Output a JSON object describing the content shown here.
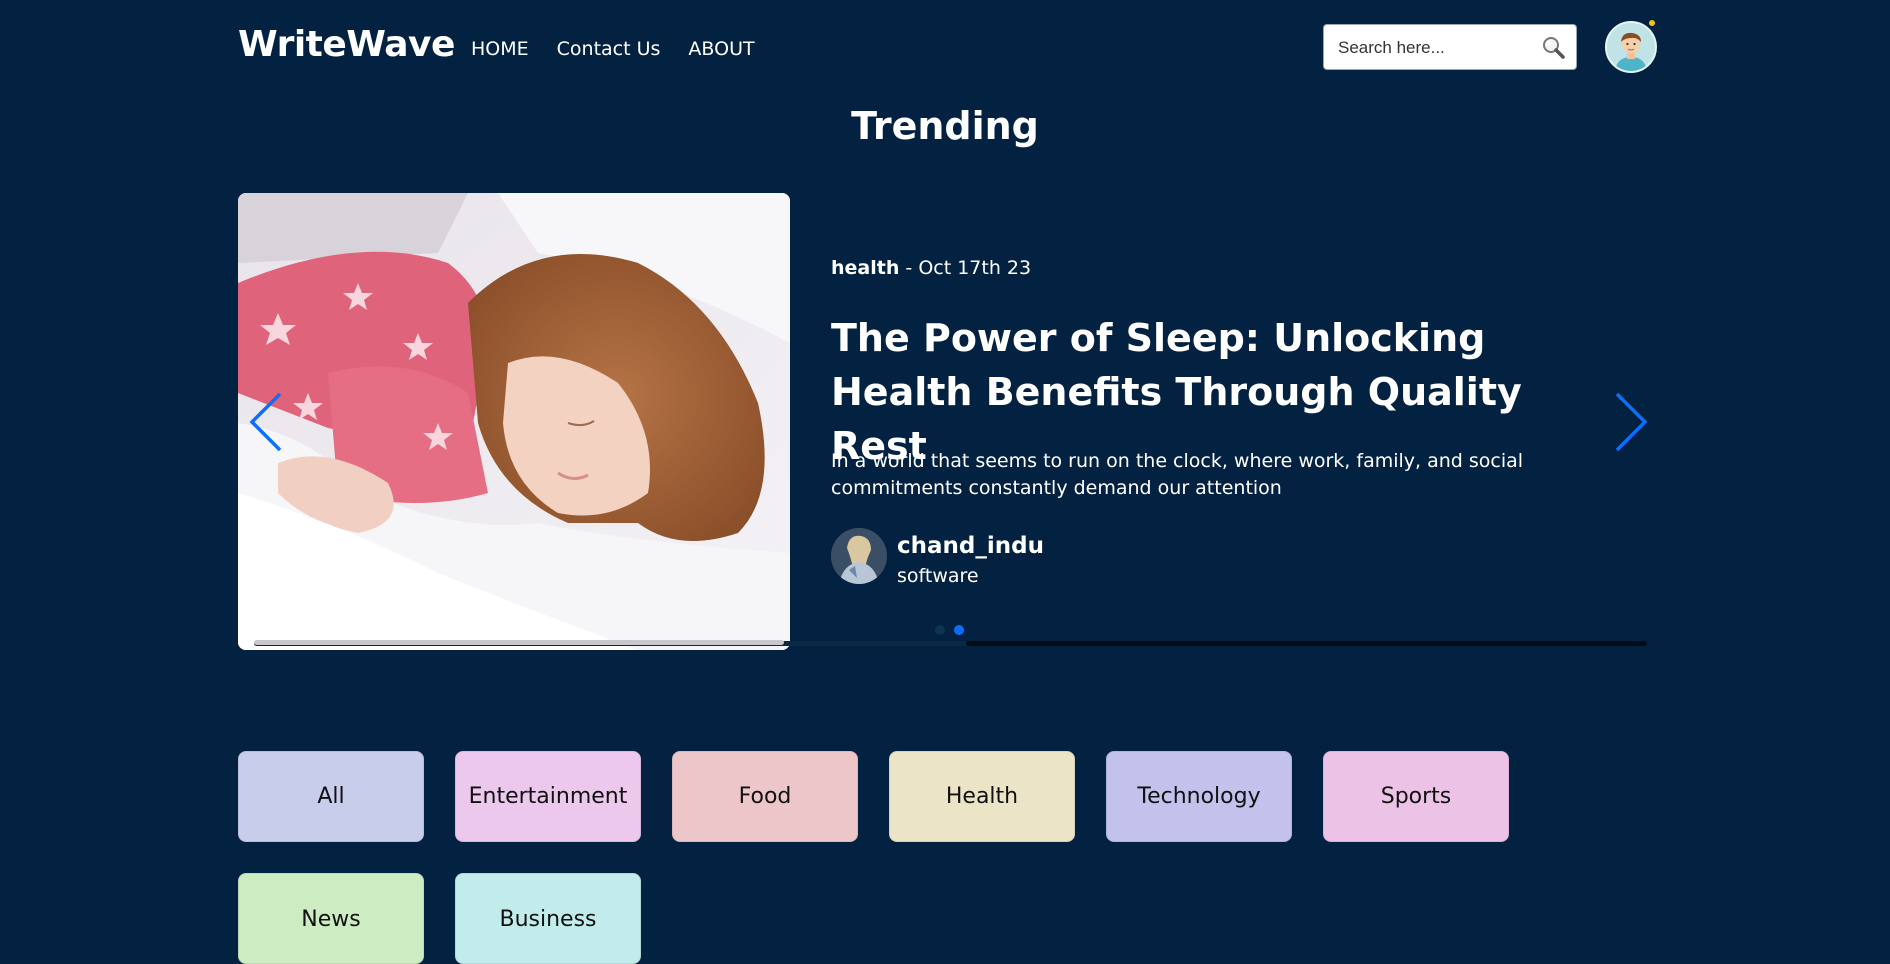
{
  "nav": {
    "logo": "WriteWave",
    "links": [
      "HOME",
      "Contact Us",
      "ABOUT"
    ],
    "search_placeholder": "Search here...",
    "search_icon": "search-icon",
    "avatar_icon": "user-avatar-icon"
  },
  "trending": {
    "title": "Trending",
    "slide": {
      "category": "health",
      "separator": "-",
      "date": "Oct 17th 23",
      "headline": "The Power of Sleep: Unlocking Health Benefits Through Quality Rest",
      "excerpt": "In a world that seems to run on the clock, where work, family, and social commitments constantly demand our attention",
      "author": {
        "name": "chand_indu",
        "role": "software"
      }
    },
    "active_dot": 2,
    "dots_total": 2,
    "arrow_color": "#0d6efd"
  },
  "categories": [
    {
      "label": "All",
      "color": "#c8cdec"
    },
    {
      "label": "Entertainment",
      "color": "#ecc8ec"
    },
    {
      "label": "Food",
      "color": "#ecc6c8"
    },
    {
      "label": "Health",
      "color": "#ece4c6"
    },
    {
      "label": "Technology",
      "color": "#c2c2ec"
    },
    {
      "label": "Sports",
      "color": "#ecc2e6"
    },
    {
      "label": "News",
      "color": "#cdecc2"
    },
    {
      "label": "Business",
      "color": "#c2ecec"
    }
  ]
}
